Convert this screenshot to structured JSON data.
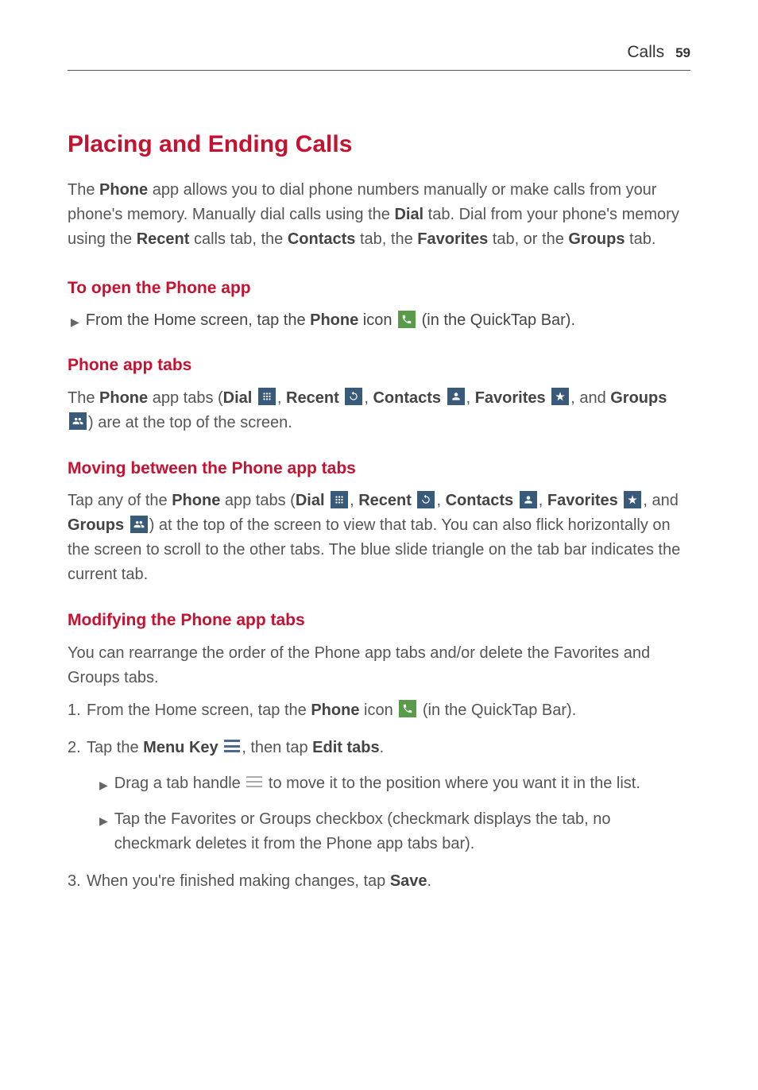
{
  "header": {
    "section": "Calls",
    "page": "59"
  },
  "title": "Placing and Ending Calls",
  "intro": {
    "t1": "The ",
    "t2": "Phone",
    "t3": " app allows you to dial phone numbers manually or make calls from your phone's memory. Manually dial calls using the ",
    "t4": "Dial",
    "t5": " tab. Dial from your phone's memory using the ",
    "t6": "Recent",
    "t7": " calls tab, the ",
    "t8": "Contacts",
    "t9": " tab, the ",
    "t10": "Favorites",
    "t11": " tab, or the ",
    "t12": "Groups",
    "t13": " tab."
  },
  "sec1": {
    "heading": "To open the Phone app",
    "b1a": "From the Home screen, tap the ",
    "b1b": "Phone",
    "b1c": " icon ",
    "b1d": " (in the QuickTap Bar)."
  },
  "sec2": {
    "heading": "Phone app tabs",
    "p1": "The ",
    "p2": "Phone",
    "p3": " app tabs (",
    "p4": "Dial",
    "p5": ", ",
    "p6": "Recent",
    "p7": ", ",
    "p8": "Contacts",
    "p9": ", ",
    "p10": "Favorites",
    "p11": ", and ",
    "p12": "Groups",
    "p13": ") are at the top of the screen."
  },
  "sec3": {
    "heading": "Moving between the Phone app tabs",
    "p1": "Tap any of the ",
    "p2": "Phone",
    "p3": " app tabs (",
    "p4": "Dial",
    "p5": ", ",
    "p6": "Recent",
    "p7": ", ",
    "p8": "Contacts",
    "p9": ", ",
    "p10": "Favorites",
    "p11": ", and ",
    "p12": "Groups",
    "p13": ") at the top of the screen to view that tab. You can also flick horizontally on the screen to scroll to the other tabs. The blue slide triangle on the tab bar indicates the current tab."
  },
  "sec4": {
    "heading": "Modifying the Phone app tabs",
    "intro": "You can rearrange the order of the Phone app tabs and/or delete the Favorites and Groups tabs.",
    "step1a": "From the Home screen, tap the ",
    "step1b": "Phone",
    "step1c": " icon ",
    "step1d": " (in the QuickTap Bar).",
    "step2a": "Tap the ",
    "step2b": "Menu Key",
    "step2c": " ",
    "step2d": ", then tap ",
    "step2e": "Edit tabs",
    "step2f": ".",
    "sub1a": "Drag a tab handle ",
    "sub1b": " to move it to the position where you want it in the list.",
    "sub2": "Tap the Favorites or Groups checkbox (checkmark displays the tab, no checkmark deletes it from the Phone app tabs bar).",
    "step3a": "When you're finished making changes, tap ",
    "step3b": "Save",
    "step3c": "."
  }
}
